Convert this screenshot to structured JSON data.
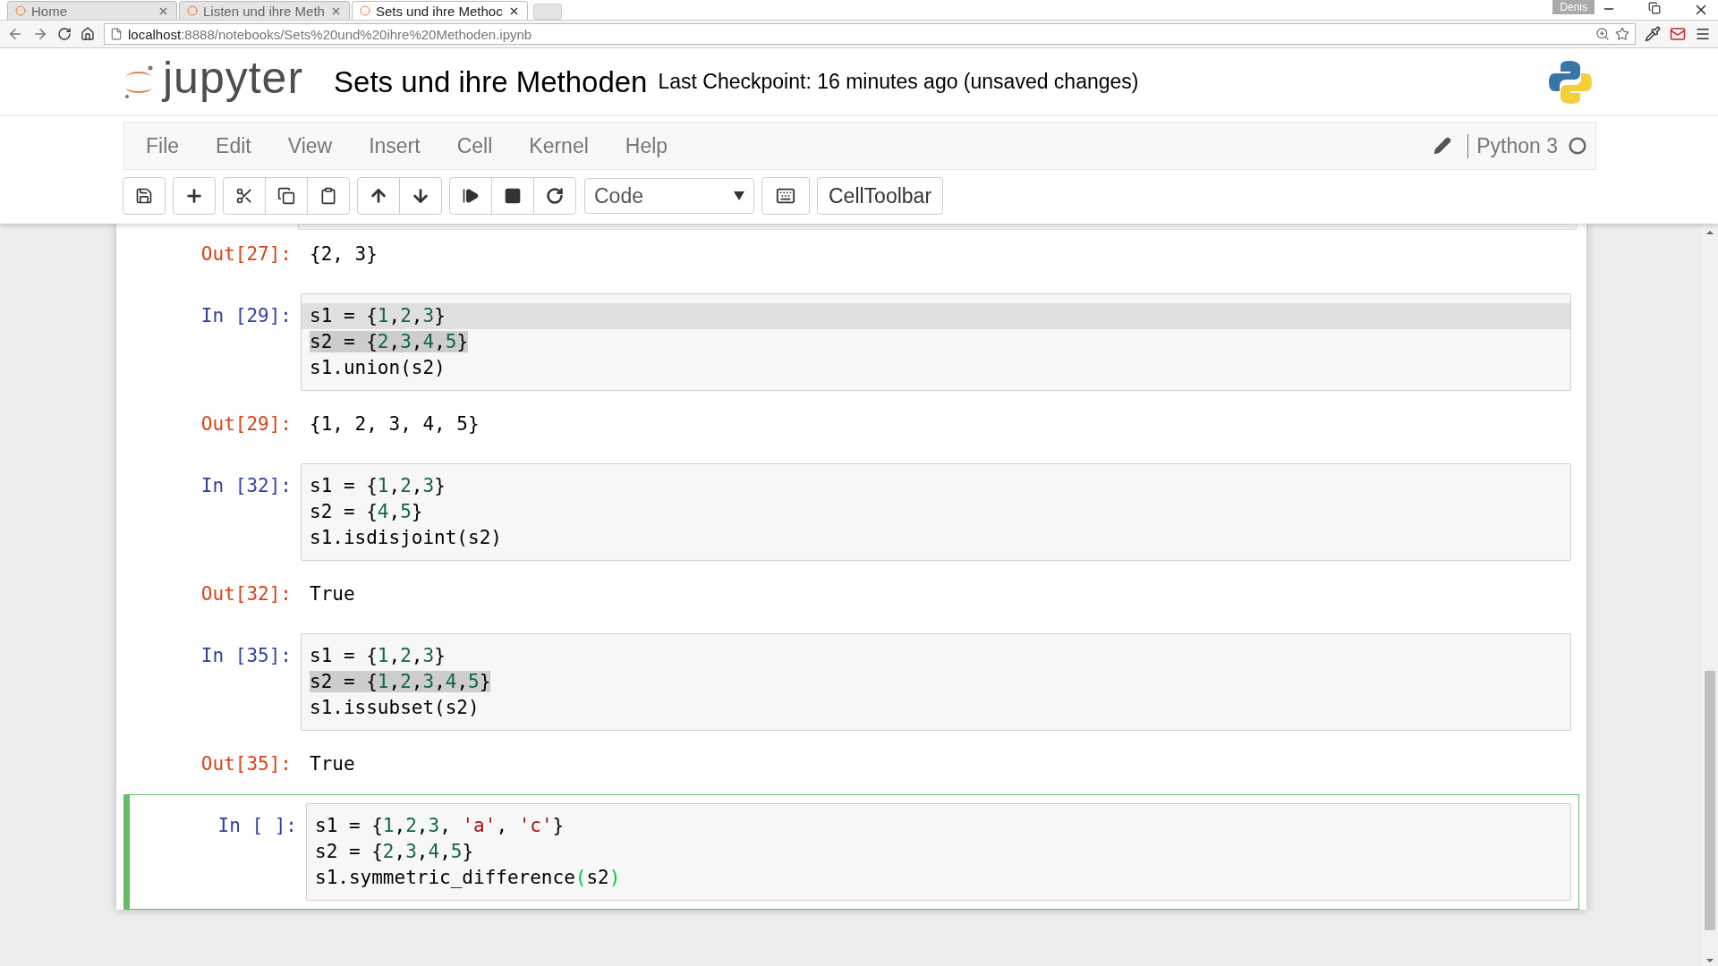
{
  "browser": {
    "tabs": [
      {
        "title": "Home",
        "selected": false
      },
      {
        "title": "Listen und ihre Meth",
        "selected": false
      },
      {
        "title": "Sets und ihre Methoc",
        "selected": true
      }
    ],
    "profile": "Denis",
    "url_host": "localhost",
    "url_path": ":8888/notebooks/Sets%20und%20ihre%20Methoden.ipynb"
  },
  "header": {
    "logo_text": "jupyter",
    "notebook_title": "Sets und ihre Methoden",
    "checkpoint": "Last Checkpoint: 16 minutes ago (unsaved changes)"
  },
  "menu": [
    "File",
    "Edit",
    "View",
    "Insert",
    "Cell",
    "Kernel",
    "Help"
  ],
  "kernel": {
    "name": "Python 3",
    "busy": false
  },
  "toolbar": {
    "cell_type": "Code",
    "celltoolbar": "CellToolbar"
  },
  "cells": [
    {
      "kind": "output",
      "prompt": "Out[27]:",
      "text": "{2, 3}",
      "selected": false
    },
    {
      "kind": "input",
      "prompt": "In [29]:",
      "selected": false,
      "lines": [
        {
          "cursor_line": true,
          "selected": false,
          "tokens": [
            {
              "kind": "text",
              "text": "s1 = {"
            },
            {
              "kind": "num",
              "text": "1"
            },
            {
              "kind": "text",
              "text": ","
            },
            {
              "kind": "num",
              "text": "2"
            },
            {
              "kind": "text",
              "text": ","
            },
            {
              "kind": "num",
              "text": "3"
            },
            {
              "kind": "text",
              "text": "}"
            }
          ]
        },
        {
          "cursor_line": false,
          "selected": true,
          "tokens": [
            {
              "kind": "text",
              "text": "s2 = {"
            },
            {
              "kind": "num",
              "text": "2"
            },
            {
              "kind": "text",
              "text": ","
            },
            {
              "kind": "num",
              "text": "3"
            },
            {
              "kind": "text",
              "text": ","
            },
            {
              "kind": "num",
              "text": "4"
            },
            {
              "kind": "text",
              "text": ","
            },
            {
              "kind": "num",
              "text": "5"
            },
            {
              "kind": "text",
              "text": "}"
            }
          ]
        },
        {
          "cursor_line": false,
          "selected": false,
          "tokens": [
            {
              "kind": "text",
              "text": "s1.union(s2)"
            }
          ]
        }
      ]
    },
    {
      "kind": "output",
      "prompt": "Out[29]:",
      "text": "{1, 2, 3, 4, 5}",
      "selected": false
    },
    {
      "kind": "input",
      "prompt": "In [32]:",
      "selected": false,
      "lines": [
        {
          "cursor_line": false,
          "selected": false,
          "tokens": [
            {
              "kind": "text",
              "text": "s1 = {"
            },
            {
              "kind": "num",
              "text": "1"
            },
            {
              "kind": "text",
              "text": ","
            },
            {
              "kind": "num",
              "text": "2"
            },
            {
              "kind": "text",
              "text": ","
            },
            {
              "kind": "num",
              "text": "3"
            },
            {
              "kind": "text",
              "text": "}"
            }
          ]
        },
        {
          "cursor_line": false,
          "selected": false,
          "tokens": [
            {
              "kind": "text",
              "text": "s2 = {"
            },
            {
              "kind": "num",
              "text": "4"
            },
            {
              "kind": "text",
              "text": ","
            },
            {
              "kind": "num",
              "text": "5"
            },
            {
              "kind": "text",
              "text": "}"
            }
          ]
        },
        {
          "cursor_line": false,
          "selected": false,
          "tokens": [
            {
              "kind": "text",
              "text": "s1.isdisjoint(s2)"
            }
          ]
        }
      ]
    },
    {
      "kind": "output",
      "prompt": "Out[32]:",
      "text": "True",
      "selected": false
    },
    {
      "kind": "input",
      "prompt": "In [35]:",
      "selected": false,
      "lines": [
        {
          "cursor_line": false,
          "selected": false,
          "tokens": [
            {
              "kind": "text",
              "text": "s1 = {"
            },
            {
              "kind": "num",
              "text": "1"
            },
            {
              "kind": "text",
              "text": ","
            },
            {
              "kind": "num",
              "text": "2"
            },
            {
              "kind": "text",
              "text": ","
            },
            {
              "kind": "num",
              "text": "3"
            },
            {
              "kind": "text",
              "text": "}"
            }
          ]
        },
        {
          "cursor_line": false,
          "selected": true,
          "tokens": [
            {
              "kind": "text",
              "text": "s2 = {"
            },
            {
              "kind": "num",
              "text": "1"
            },
            {
              "kind": "text",
              "text": ","
            },
            {
              "kind": "num",
              "text": "2"
            },
            {
              "kind": "text",
              "text": ","
            },
            {
              "kind": "num",
              "text": "3"
            },
            {
              "kind": "text",
              "text": ","
            },
            {
              "kind": "num",
              "text": "4"
            },
            {
              "kind": "text",
              "text": ","
            },
            {
              "kind": "num",
              "text": "5"
            },
            {
              "kind": "text",
              "text": "}"
            }
          ]
        },
        {
          "cursor_line": false,
          "selected": false,
          "tokens": [
            {
              "kind": "text",
              "text": "s1.issubset(s2)"
            }
          ]
        }
      ]
    },
    {
      "kind": "output",
      "prompt": "Out[35]:",
      "text": "True",
      "selected": false
    },
    {
      "kind": "input",
      "prompt": "In [ ]:",
      "selected": true,
      "lines": [
        {
          "cursor_line": false,
          "selected": false,
          "tokens": [
            {
              "kind": "text",
              "text": "s1 = {"
            },
            {
              "kind": "num",
              "text": "1"
            },
            {
              "kind": "text",
              "text": ","
            },
            {
              "kind": "num",
              "text": "2"
            },
            {
              "kind": "text",
              "text": ","
            },
            {
              "kind": "num",
              "text": "3"
            },
            {
              "kind": "text",
              "text": ", "
            },
            {
              "kind": "str",
              "text": "'a'"
            },
            {
              "kind": "text",
              "text": ", "
            },
            {
              "kind": "str",
              "text": "'c'"
            },
            {
              "kind": "text",
              "text": "}"
            }
          ]
        },
        {
          "cursor_line": false,
          "selected": false,
          "tokens": [
            {
              "kind": "text",
              "text": "s2 = {"
            },
            {
              "kind": "num",
              "text": "2"
            },
            {
              "kind": "text",
              "text": ","
            },
            {
              "kind": "num",
              "text": "3"
            },
            {
              "kind": "text",
              "text": ","
            },
            {
              "kind": "num",
              "text": "4"
            },
            {
              "kind": "text",
              "text": ","
            },
            {
              "kind": "num",
              "text": "5"
            },
            {
              "kind": "text",
              "text": "}"
            }
          ]
        },
        {
          "cursor_line": false,
          "selected": false,
          "tokens": [
            {
              "kind": "text",
              "text": "s1.symmetric_difference"
            },
            {
              "kind": "match",
              "text": "("
            },
            {
              "kind": "text",
              "text": "s2"
            },
            {
              "kind": "match",
              "text": ")"
            }
          ]
        }
      ]
    }
  ]
}
